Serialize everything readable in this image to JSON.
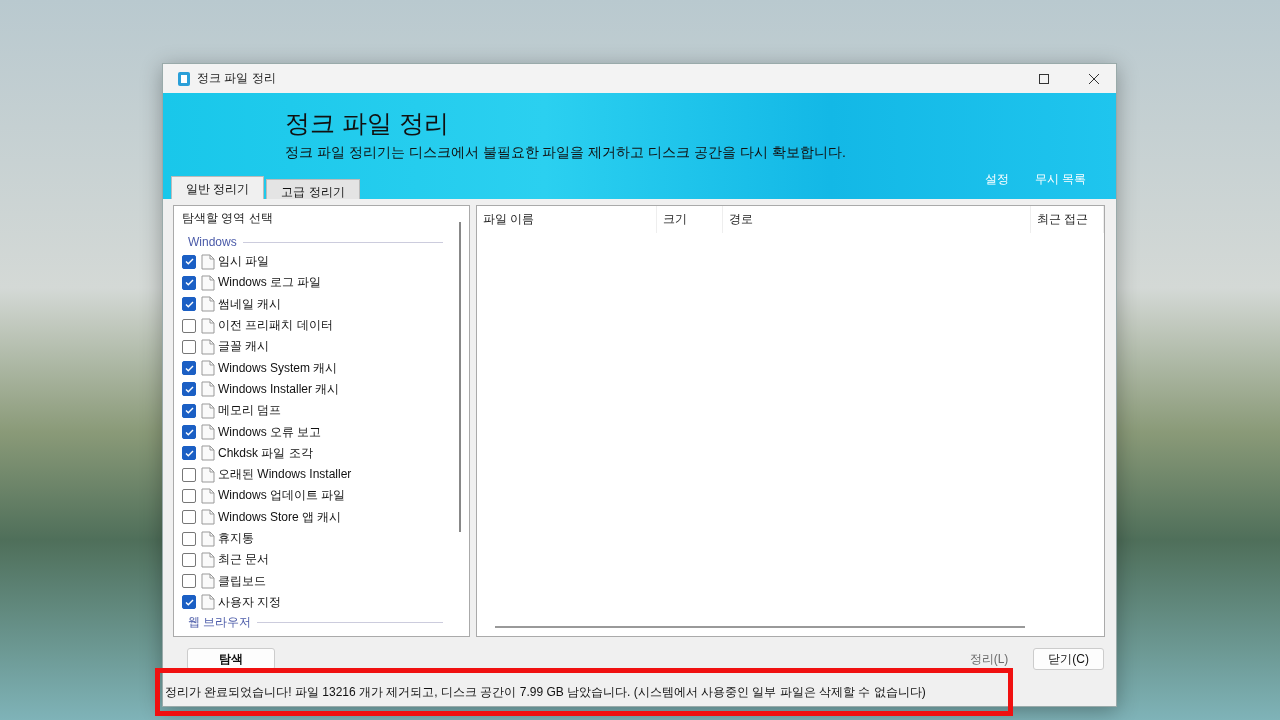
{
  "window": {
    "title": "정크 파일 정리"
  },
  "banner": {
    "title": "정크 파일 정리",
    "subtitle": "정크 파일 정리기는 디스크에서 불필요한 파일을 제거하고 디스크 공간을 다시 확보합니다.",
    "links": [
      "설정",
      "무시 목록"
    ]
  },
  "tabs": [
    {
      "label": "일반 정리기",
      "selected": true
    },
    {
      "label": "고급 정리기",
      "selected": false
    }
  ],
  "area_list": {
    "heading": "탐색할 영역 선택",
    "items": [
      {
        "kind": "group",
        "label": "Windows"
      },
      {
        "kind": "item",
        "label": "임시 파일",
        "checked": true
      },
      {
        "kind": "item",
        "label": "Windows 로그 파일",
        "checked": true
      },
      {
        "kind": "item",
        "label": "썸네일 캐시",
        "checked": true
      },
      {
        "kind": "item",
        "label": "이전 프리패치 데이터",
        "checked": false
      },
      {
        "kind": "item",
        "label": "글꼴 캐시",
        "checked": false
      },
      {
        "kind": "item",
        "label": "Windows System 캐시",
        "checked": true
      },
      {
        "kind": "item",
        "label": "Windows Installer 캐시",
        "checked": true
      },
      {
        "kind": "item",
        "label": "메모리 덤프",
        "checked": true
      },
      {
        "kind": "item",
        "label": "Windows 오류 보고",
        "checked": true
      },
      {
        "kind": "item",
        "label": "Chkdsk 파일 조각",
        "checked": true
      },
      {
        "kind": "item",
        "label": "오래된 Windows Installer",
        "checked": false
      },
      {
        "kind": "item",
        "label": "Windows 업데이트 파일",
        "checked": false
      },
      {
        "kind": "item",
        "label": "Windows Store 앱 캐시",
        "checked": false
      },
      {
        "kind": "item",
        "label": "휴지통",
        "checked": false
      },
      {
        "kind": "item",
        "label": "최근 문서",
        "checked": false
      },
      {
        "kind": "item",
        "label": "클립보드",
        "checked": false
      },
      {
        "kind": "item",
        "label": "사용자 지정",
        "checked": true
      },
      {
        "kind": "group",
        "label": "웹 브라우저"
      }
    ]
  },
  "table": {
    "columns": [
      "파일 이름",
      "크기",
      "경로",
      "최근 접근"
    ]
  },
  "buttons": [
    {
      "label": "탐색",
      "disabled": false
    },
    {
      "label": "정리(L)",
      "disabled": true
    },
    {
      "label": "닫기(C)",
      "disabled": false
    }
  ],
  "status_bar": {
    "text": "정리가 완료되었습니다!  파일 13216 개가 제거되고, 디스크 공간이 7.99 GB 남았습니다. (시스템에서 사용중인 일부 파일은 삭제할 수 없습니다)",
    "highlighted": true
  }
}
